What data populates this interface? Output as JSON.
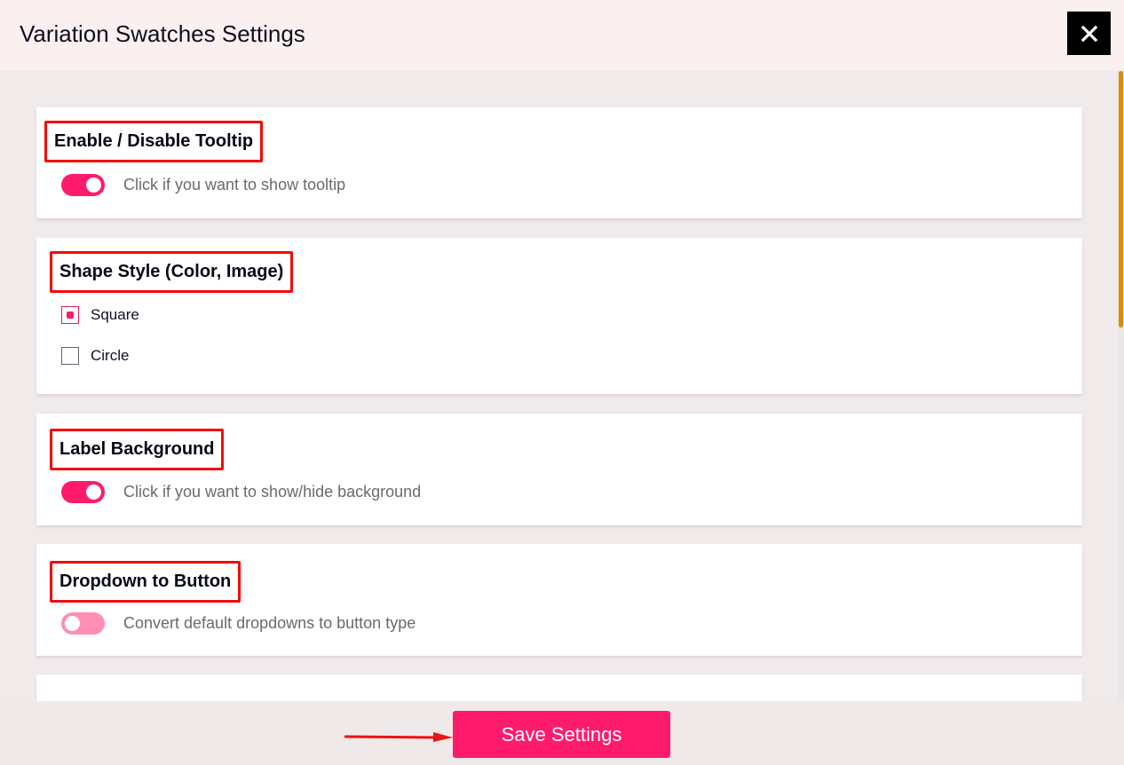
{
  "dialog": {
    "title": "Variation Swatches Settings",
    "close_icon": "close-icon"
  },
  "sections": [
    {
      "title": "Enable / Disable Tooltip",
      "type": "toggle",
      "enabled": true,
      "description": "Click if you want to show tooltip"
    },
    {
      "title": "Shape Style (Color, Image)",
      "type": "radio",
      "selected": "Square",
      "options": [
        "Square",
        "Circle"
      ]
    },
    {
      "title": "Label Background",
      "type": "toggle",
      "enabled": true,
      "description": "Click if you want to show/hide background"
    },
    {
      "title": "Dropdown to Button",
      "type": "toggle",
      "enabled": false,
      "description": "Convert default dropdowns to button type"
    }
  ],
  "footer": {
    "save_label": "Save Settings",
    "annotation_icon": "arrow-right-icon"
  },
  "colors": {
    "accent": "#ff1a6b",
    "accent_off": "#ff8db5",
    "highlight_border": "#f40a0a",
    "scrollbar": "#de8a0a",
    "close_bg": "#000000"
  }
}
